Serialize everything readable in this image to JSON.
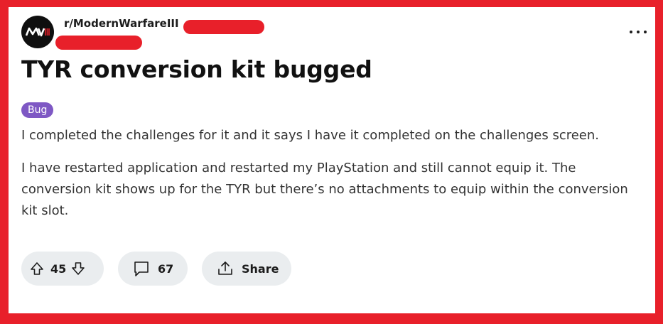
{
  "post": {
    "subreddit": "r/ModernWarfareIII",
    "avatar_text": "MW III",
    "avatar_icon": "mw3-logo-icon",
    "title": "TYR conversion kit bugged",
    "flair": "Bug",
    "body": [
      "I completed the challenges for it and it says I have it completed on the challenges screen.",
      "I have restarted application and restarted my PlayStation and still cannot equip it. The conversion kit shows up for the TYR but there’s no attachments to equip within the conversion kit slot."
    ]
  },
  "actions": {
    "upvotes": "45",
    "comments": "67",
    "share_label": "Share"
  },
  "colors": {
    "frame": "#e8202a",
    "redaction": "#e8202a",
    "flair_bg": "#7e58c4",
    "pill_bg": "#eaedef"
  },
  "icons": [
    "upvote-icon",
    "downvote-icon",
    "comment-icon",
    "share-icon",
    "more-options-icon"
  ]
}
